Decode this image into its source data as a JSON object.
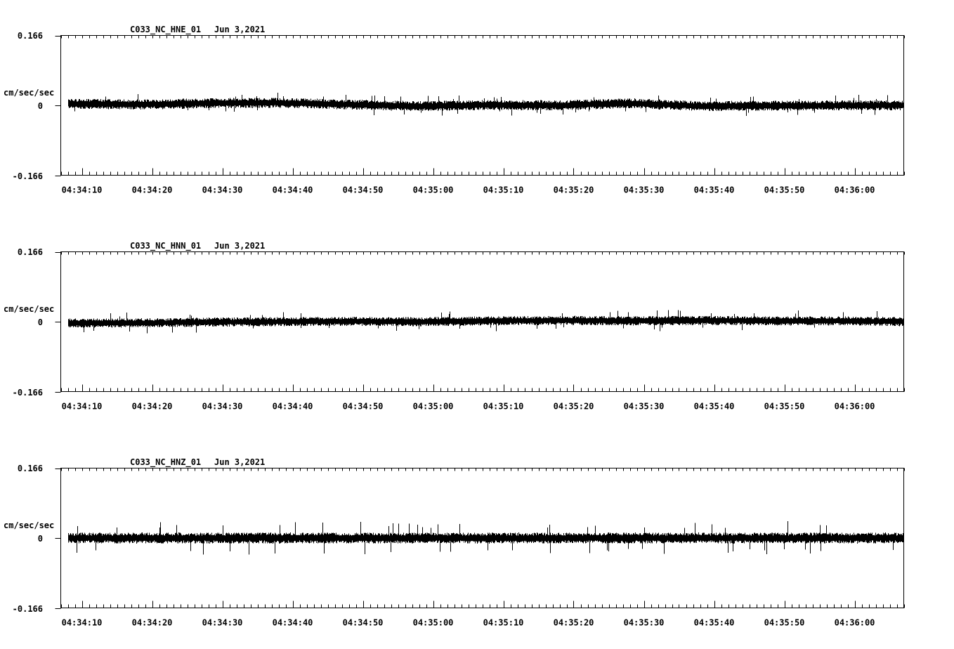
{
  "colors": {
    "background": "#ffffff",
    "axis": "#000000",
    "trace": "#000000"
  },
  "chart_data": [
    {
      "type": "line",
      "title": "C033_NC_HNE_01",
      "date": "Jun 3,2021",
      "ylabel": "cm/sec/sec",
      "ylim": [
        -0.166,
        0.166
      ],
      "y_tick_labels": [
        "0.166",
        "0",
        "-0.166"
      ],
      "x_tick_labels": [
        "04:34:10",
        "04:34:20",
        "04:34:30",
        "04:34:40",
        "04:34:50",
        "04:35:00",
        "04:35:10",
        "04:35:20",
        "04:35:30",
        "04:35:40",
        "04:35:50",
        "04:36:00"
      ],
      "xlim": [
        "04:34:07",
        "04:36:07"
      ],
      "data_start": "04:34:08",
      "data_end": "04:36:07",
      "grid": false,
      "series": [
        {
          "noise_amplitude": 0.012,
          "peak_amplitude": 0.025,
          "trend": [
            [
              0,
              0.004
            ],
            [
              10,
              0.002
            ],
            [
              20,
              0.005
            ],
            [
              30,
              0.006
            ],
            [
              40,
              0.002
            ],
            [
              50,
              -0.002
            ],
            [
              60,
              0.001
            ],
            [
              70,
              0.0
            ],
            [
              80,
              0.005
            ],
            [
              90,
              -0.002
            ],
            [
              100,
              -0.001
            ],
            [
              110,
              0.0
            ],
            [
              119,
              0.0
            ]
          ]
        }
      ]
    },
    {
      "type": "line",
      "title": "C033_NC_HNN_01",
      "date": "Jun 3,2021",
      "ylabel": "cm/sec/sec",
      "ylim": [
        -0.166,
        0.166
      ],
      "y_tick_labels": [
        "0.166",
        "0",
        "-0.166"
      ],
      "x_tick_labels": [
        "04:34:10",
        "04:34:20",
        "04:34:30",
        "04:34:40",
        "04:34:50",
        "04:35:00",
        "04:35:10",
        "04:35:20",
        "04:35:30",
        "04:35:40",
        "04:35:50",
        "04:36:00"
      ],
      "xlim": [
        "04:34:07",
        "04:36:07"
      ],
      "data_start": "04:34:08",
      "data_end": "04:36:07",
      "grid": false,
      "series": [
        {
          "noise_amplitude": 0.011,
          "peak_amplitude": 0.025,
          "trend": [
            [
              0,
              -0.003
            ],
            [
              10,
              -0.003
            ],
            [
              20,
              -0.001
            ],
            [
              30,
              0.0
            ],
            [
              40,
              0.001
            ],
            [
              50,
              0.0
            ],
            [
              60,
              0.002
            ],
            [
              70,
              0.003
            ],
            [
              80,
              0.002
            ],
            [
              90,
              0.003
            ],
            [
              100,
              0.002
            ],
            [
              110,
              0.002
            ],
            [
              119,
              0.0
            ]
          ]
        }
      ]
    },
    {
      "type": "line",
      "title": "C033_NC_HNZ_01",
      "date": "Jun 3,2021",
      "ylabel": "cm/sec/sec",
      "ylim": [
        -0.166,
        0.166
      ],
      "y_tick_labels": [
        "0.166",
        "0",
        "-0.166"
      ],
      "x_tick_labels": [
        "04:34:10",
        "04:34:20",
        "04:34:30",
        "04:34:40",
        "04:34:50",
        "04:35:00",
        "04:35:10",
        "04:35:20",
        "04:35:30",
        "04:35:40",
        "04:35:50",
        "04:36:00"
      ],
      "xlim": [
        "04:34:07",
        "04:36:07"
      ],
      "data_start": "04:34:08",
      "data_end": "04:36:07",
      "grid": false,
      "series": [
        {
          "noise_amplitude": 0.013,
          "peak_amplitude": 0.04,
          "trend": [
            [
              0,
              0.0
            ],
            [
              20,
              0.0
            ],
            [
              40,
              0.0
            ],
            [
              60,
              0.0
            ],
            [
              80,
              0.0
            ],
            [
              100,
              0.0
            ],
            [
              119,
              0.0
            ]
          ]
        }
      ]
    }
  ]
}
